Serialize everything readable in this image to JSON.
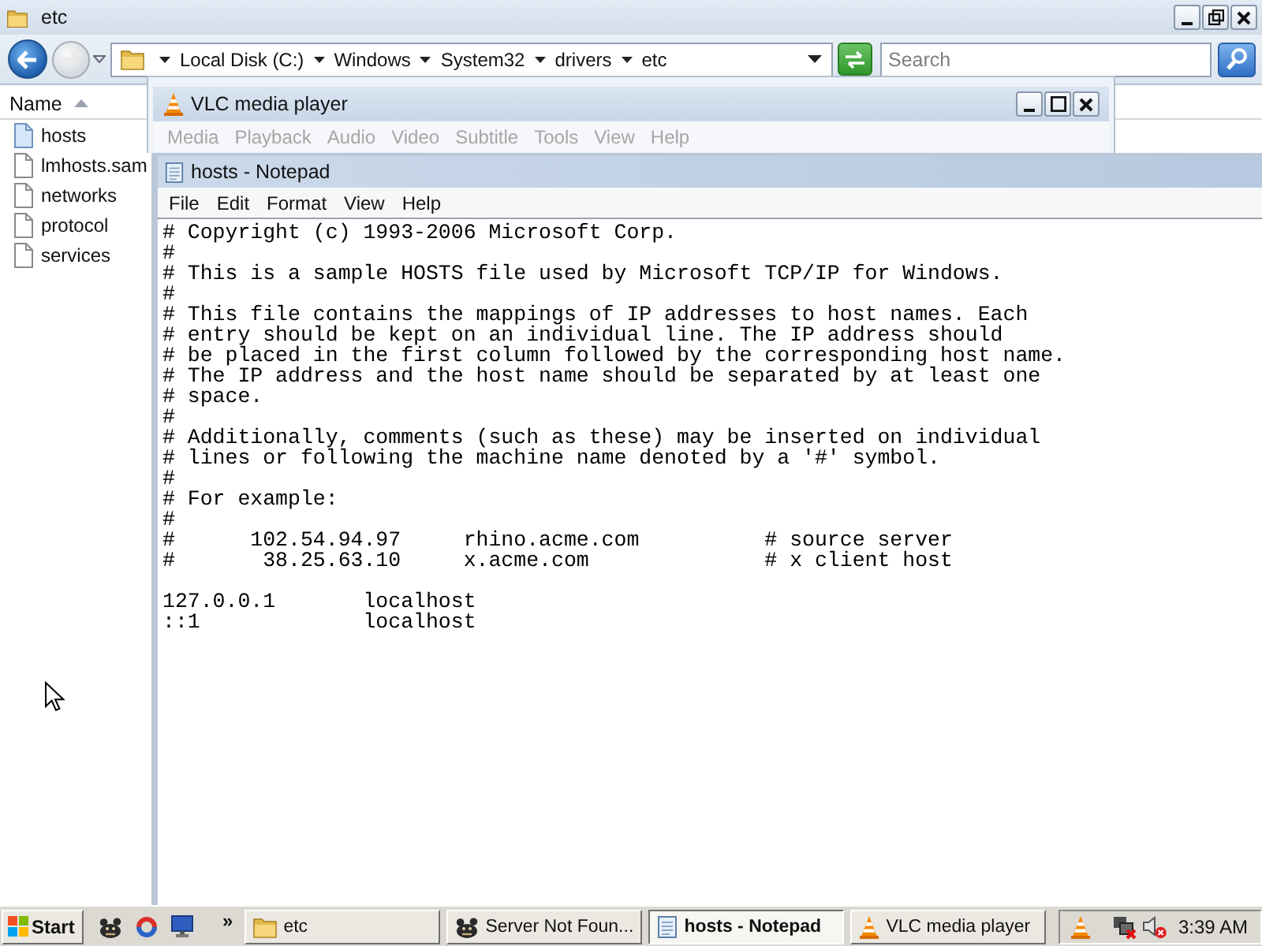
{
  "explorer": {
    "title": "etc",
    "breadcrumb": [
      "Local Disk (C:)",
      "Windows",
      "System32",
      "drivers",
      "etc"
    ],
    "search": {
      "placeholder": "Search"
    },
    "column": "Name",
    "files": [
      {
        "name": "hosts",
        "selected": true
      },
      {
        "name": "lmhosts.sam",
        "selected": false
      },
      {
        "name": "networks",
        "selected": false
      },
      {
        "name": "protocol",
        "selected": false
      },
      {
        "name": "services",
        "selected": false
      }
    ]
  },
  "vlc": {
    "title": "VLC media player",
    "menu": [
      {
        "label": "Media",
        "disabled": true
      },
      {
        "label": "Playback",
        "disabled": true
      },
      {
        "label": "Audio",
        "disabled": true
      },
      {
        "label": "Video",
        "disabled": true
      },
      {
        "label": "Subtitle",
        "disabled": true
      },
      {
        "label": "Tools",
        "disabled": true
      },
      {
        "label": "View",
        "disabled": true
      },
      {
        "label": "Help",
        "disabled": true
      }
    ]
  },
  "notepad": {
    "title": "hosts - Notepad",
    "menu": [
      "File",
      "Edit",
      "Format",
      "View",
      "Help"
    ],
    "blocks": [
      [
        "# Copyright (c) 1993-2006 Microsoft Corp.",
        "#",
        "# This is a sample HOSTS file used by Microsoft TCP/IP for Windows.",
        "#",
        "# This file contains the mappings of IP addresses to host names. Each",
        "# entry should be kept on an individual line. The IP address should",
        "# be placed in the first column followed by the corresponding host name.",
        "# The IP address and the host name should be separated by at least one",
        "# space.",
        "#",
        "# Additionally, comments (such as these) may be inserted on individual",
        "# lines or following the machine name denoted by a '#' symbol.",
        "#",
        "# For example:",
        "#",
        "#      102.54.94.97     rhino.acme.com          # source server",
        "#       38.25.63.10     x.acme.com              # x client host"
      ],
      [
        "127.0.0.1       localhost",
        "::1             localhost"
      ]
    ]
  },
  "taskbar": {
    "start": "Start",
    "quick_launch": [
      {
        "kind": "creature"
      },
      {
        "kind": "ring"
      },
      {
        "kind": "monitor"
      }
    ],
    "overflow": "»",
    "tasks": [
      {
        "label": "etc",
        "kind": "folder",
        "selected": false
      },
      {
        "label": "Server Not Foun...",
        "kind": "creature",
        "selected": false
      },
      {
        "label": "hosts - Notepad",
        "kind": "notepad",
        "selected": true
      },
      {
        "label": "VLC media player",
        "kind": "cone",
        "selected": false
      }
    ],
    "tray": [
      {
        "kind": "cone"
      },
      {
        "kind": "network-offline"
      },
      {
        "kind": "volume-muted"
      }
    ],
    "clock": "3:39 AM"
  }
}
